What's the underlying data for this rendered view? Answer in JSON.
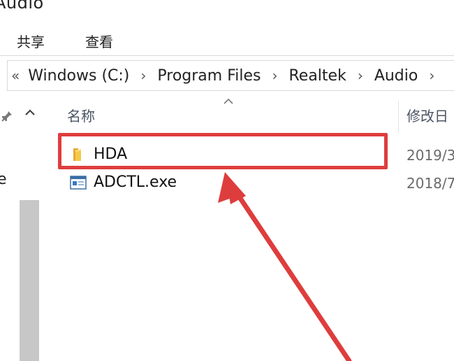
{
  "window": {
    "title": "Audio"
  },
  "ribbon": {
    "tabs": [
      {
        "label": "共享"
      },
      {
        "label": "查看"
      }
    ]
  },
  "address": {
    "overflow": "«",
    "separator": "›",
    "crumbs": [
      "Windows (C:)",
      "Program Files",
      "Realtek",
      "Audio"
    ]
  },
  "nav_pane": {
    "partial_text": "e",
    "pin_icon": "pin-icon",
    "scroll_up_icon": "chevron-up-icon"
  },
  "file_list": {
    "columns": {
      "name": "名称",
      "date": "修改日"
    },
    "sort_icon": "sort-caret-up-icon",
    "rows": [
      {
        "name": "HDA",
        "date": "2019/3",
        "icon": "folder-icon"
      },
      {
        "name": "ADCTL.exe",
        "date": "2018/7",
        "icon": "exe-icon"
      }
    ]
  },
  "annotation": {
    "color": "#de3d3d",
    "highlight_target": "HDA"
  }
}
